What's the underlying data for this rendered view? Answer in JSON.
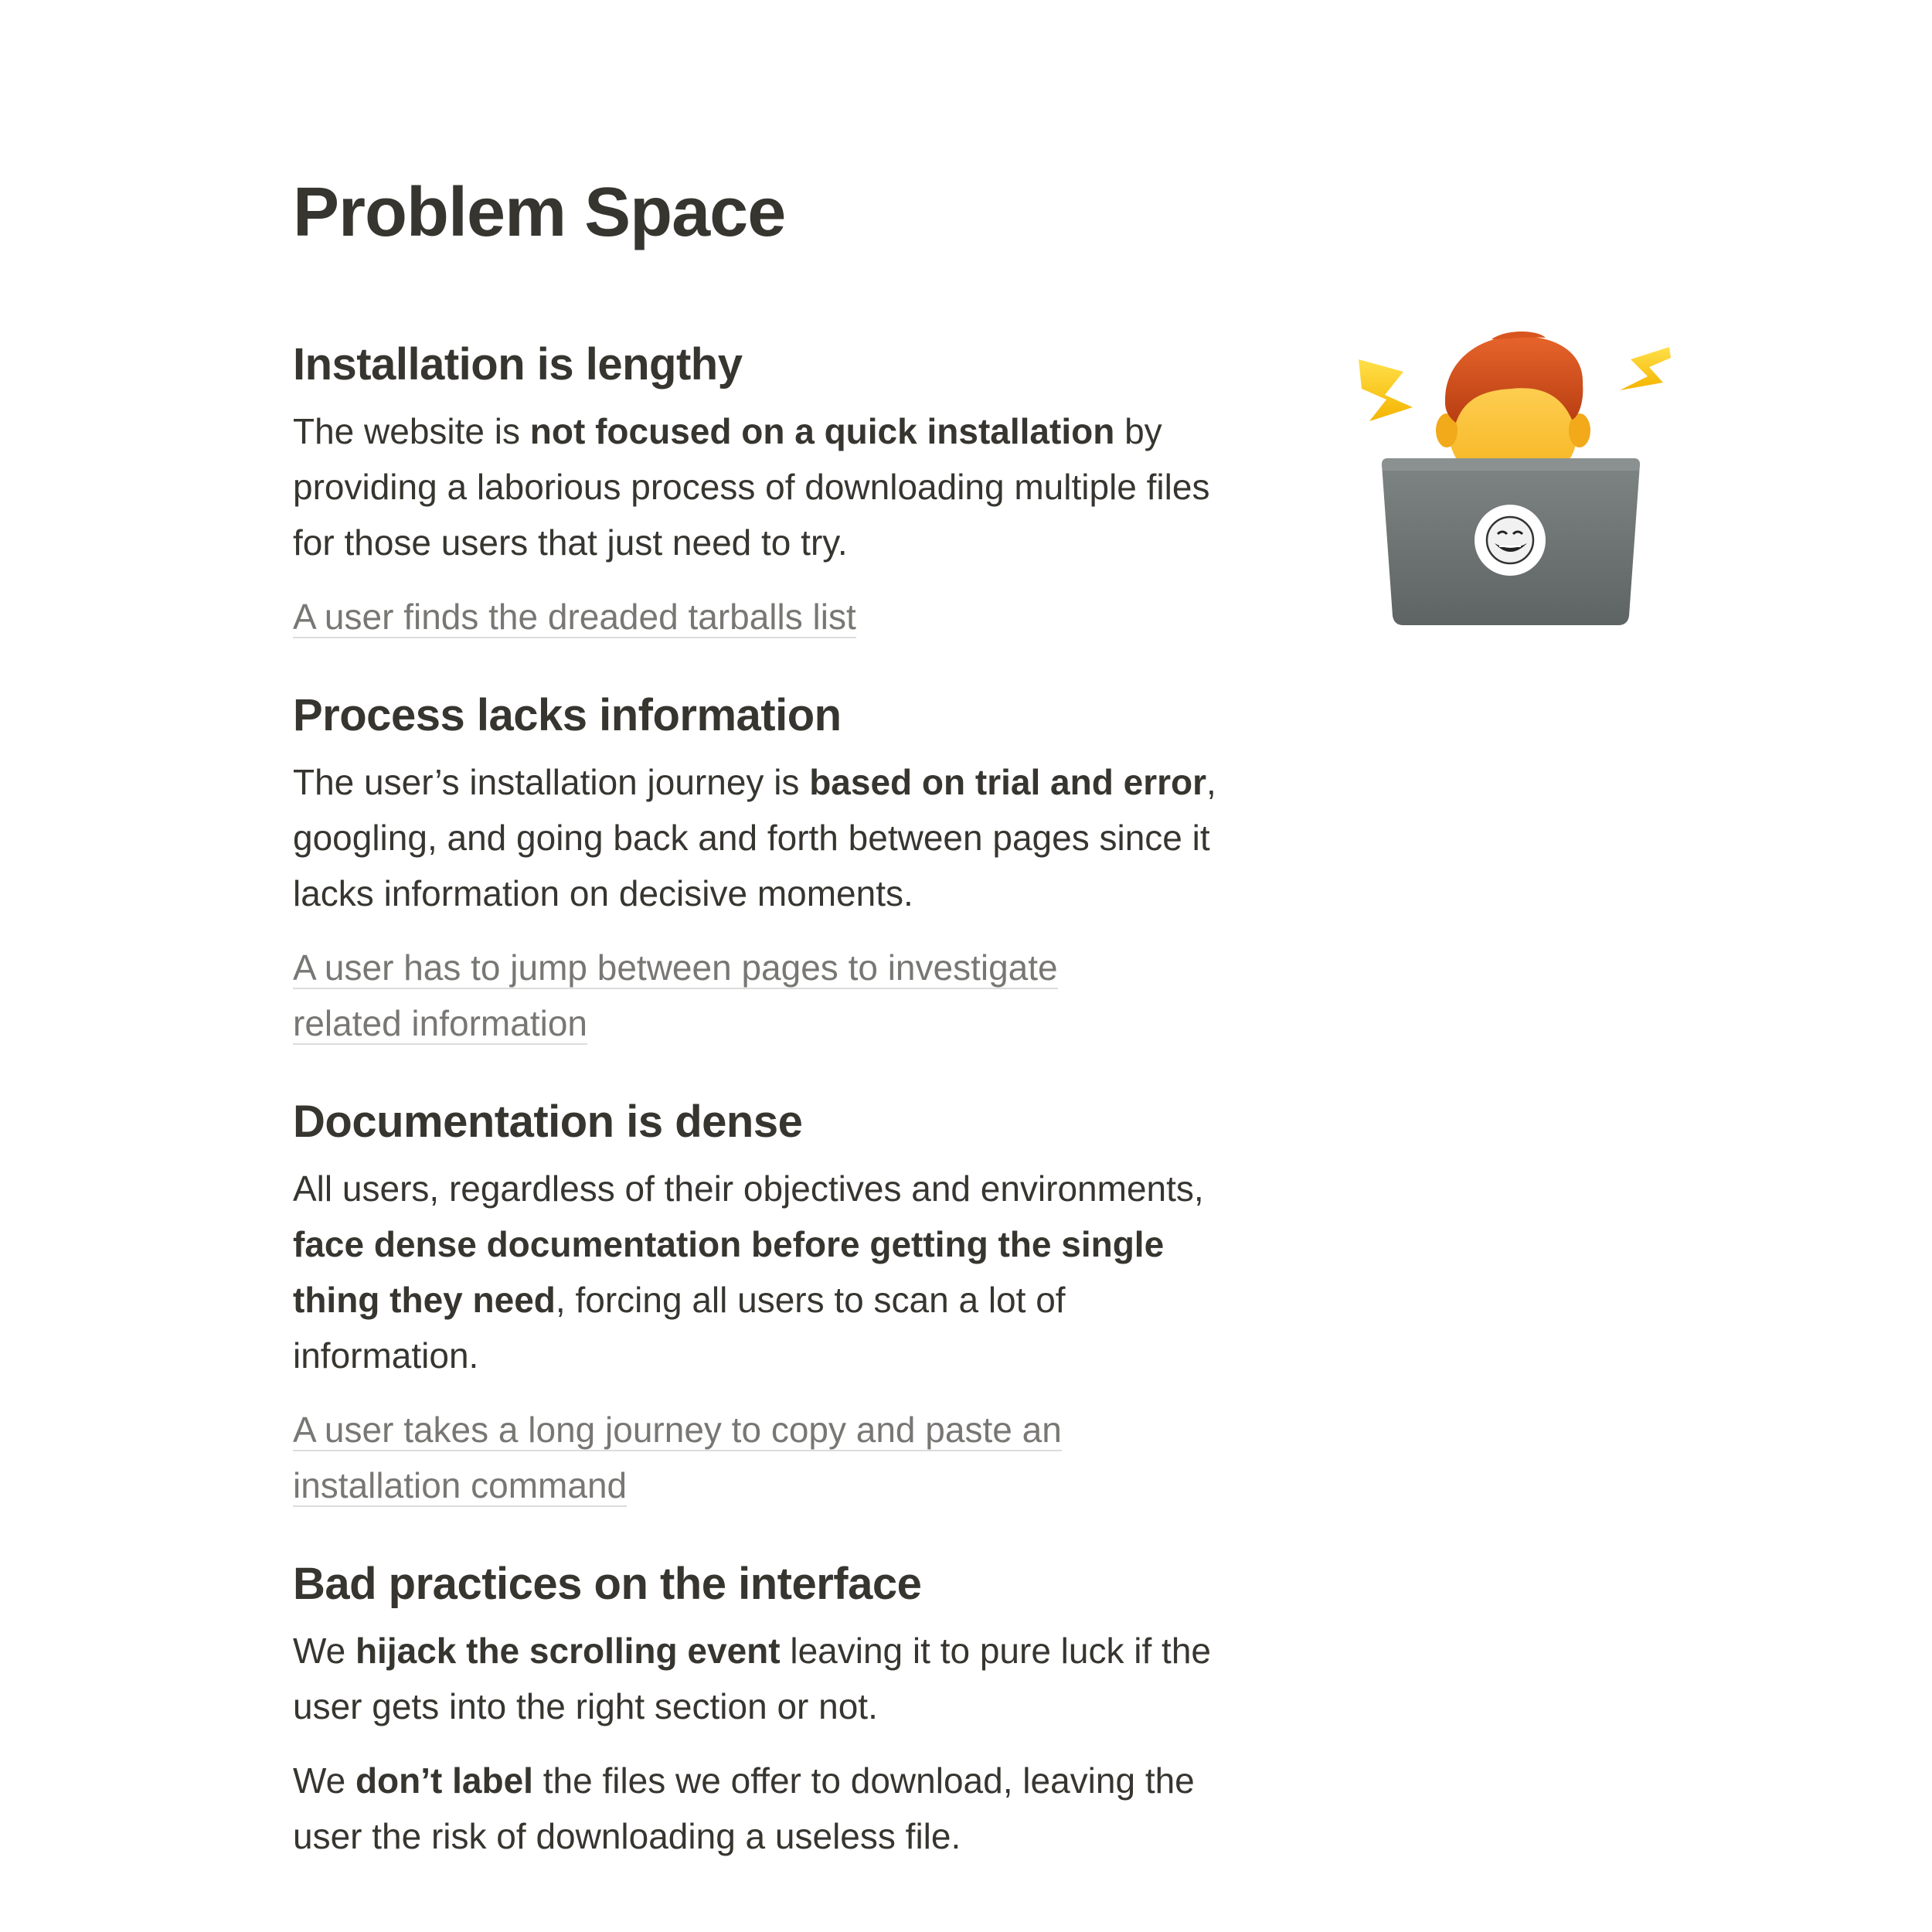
{
  "page": {
    "title": "Problem Space"
  },
  "illustration": {
    "icon": "developer-with-laptop-memoji-icon"
  },
  "sections": [
    {
      "heading": "Installation is lengthy",
      "paragraphs": [
        [
          "The website is ",
          "not focused on a quick installation",
          " by providing a laborious process of downloading multiple files for those users that just need to try."
        ]
      ],
      "link": "A user finds the dreaded tarballs list"
    },
    {
      "heading": "Process lacks information",
      "paragraphs": [
        [
          "The user’s installation journey is ",
          "based on trial and error",
          ", googling, and going back and forth between pages since it lacks information on decisive moments."
        ]
      ],
      "link": "A user has to jump between pages to investigate related information"
    },
    {
      "heading": "Documentation is dense",
      "paragraphs": [
        [
          "All users, regardless of their objectives and environments, ",
          "face dense documentation before getting the single thing they need",
          ", forcing all users to scan a lot of information."
        ]
      ],
      "link": "A user takes a long journey to copy and paste an installation command"
    },
    {
      "heading": "Bad practices on the interface",
      "paragraphs": [
        [
          "We ",
          "hijack the scrolling event",
          " leaving it to pure luck if the user gets into the right section or not."
        ],
        [
          "We ",
          "don’t label",
          " the files we offer to download, leaving the user the risk of downloading a useless file."
        ]
      ]
    }
  ]
}
